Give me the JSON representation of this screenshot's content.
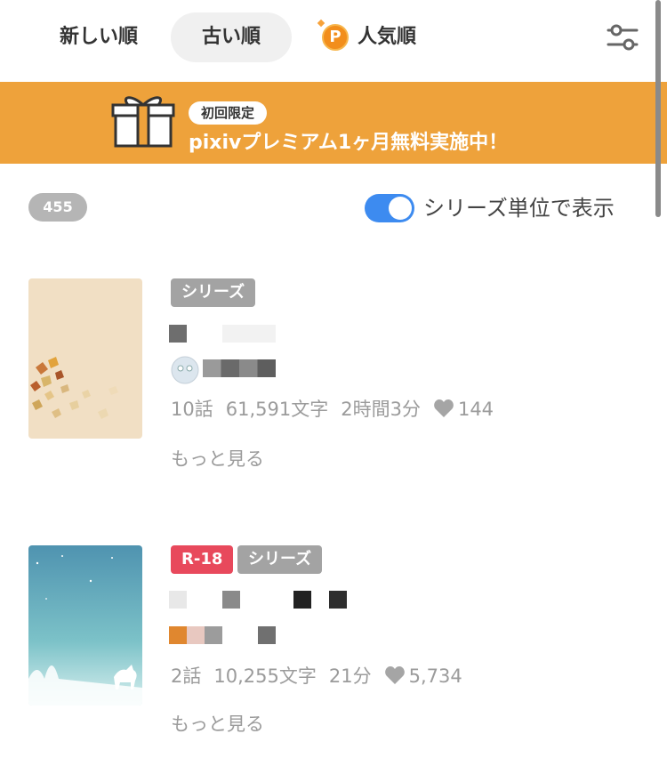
{
  "sort_tabs": {
    "newest": "新しい順",
    "oldest": "古い順",
    "popular": "人気順",
    "popular_badge": "P"
  },
  "banner": {
    "badge": "初回限定",
    "text": "pixivプレミアム1ヶ月無料実施中！",
    "color": "#eea23b"
  },
  "results": {
    "count": "455",
    "toggle_label": "シリーズ単位で表示",
    "toggle_on": true
  },
  "series": [
    {
      "tags": [
        "シリーズ"
      ],
      "episodes": "10話",
      "chars": "61,591文字",
      "read_time": "2時間3分",
      "likes": "144",
      "more": "もっと見る"
    },
    {
      "tags": [
        "R-18",
        "シリーズ"
      ],
      "episodes": "2話",
      "chars": "10,255文字",
      "read_time": "21分",
      "likes": "5,734",
      "more": "もっと見る"
    }
  ],
  "colors": {
    "accent": "#3d8bf0",
    "r18": "#e8495c",
    "tag_gray": "#a3a3a3",
    "premium_orange": "#f28e1c"
  }
}
